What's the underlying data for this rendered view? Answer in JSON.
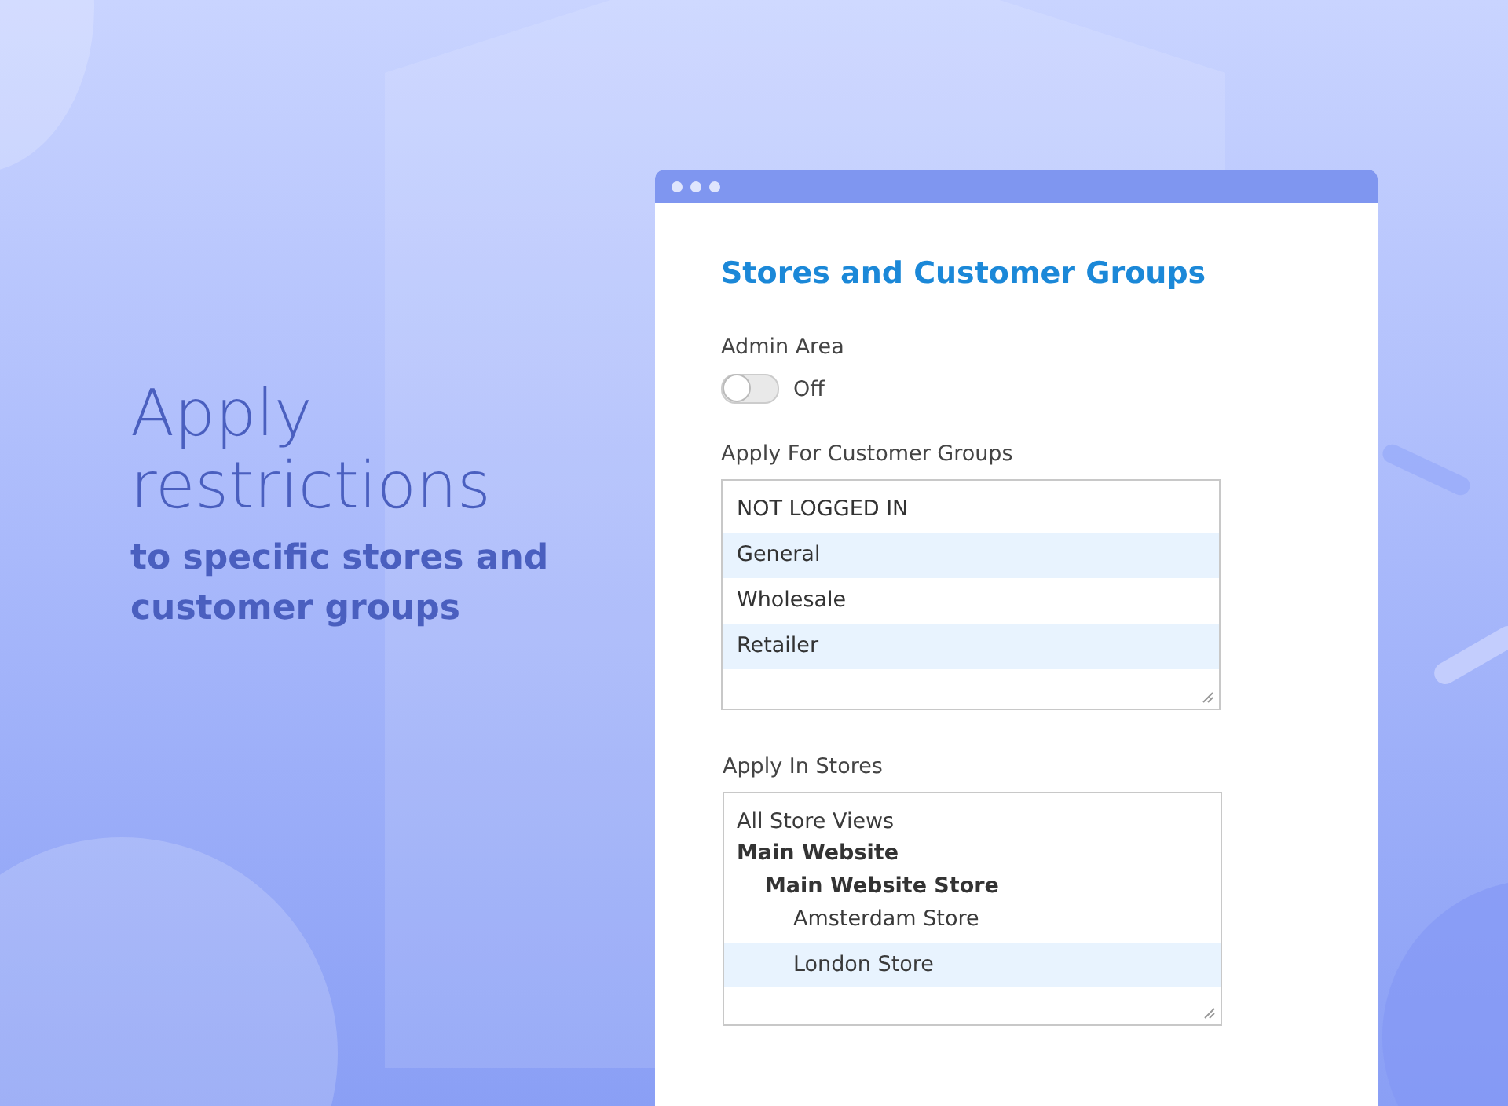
{
  "hero": {
    "headline": "Apply restrictions",
    "subline": "to specific stores and customer groups"
  },
  "window": {
    "title": "Stores and Customer Groups",
    "admin_area": {
      "label": "Admin Area",
      "on": false,
      "state_text": "Off"
    },
    "customer_groups": {
      "label": "Apply For Customer Groups",
      "items": [
        {
          "label": "NOT LOGGED IN",
          "selected": false
        },
        {
          "label": "General",
          "selected": true
        },
        {
          "label": "Wholesale",
          "selected": false
        },
        {
          "label": "Retailer",
          "selected": true
        }
      ]
    },
    "stores": {
      "label": "Apply In Stores",
      "items": [
        {
          "label": "All Store Views",
          "kind": "option",
          "selected": false
        },
        {
          "label": "Main Website",
          "kind": "group",
          "selected": false,
          "children": [
            {
              "label": "Main Website Store",
              "kind": "group",
              "selected": false,
              "children": [
                {
                  "label": "Amsterdam Store",
                  "kind": "option",
                  "selected": false
                },
                {
                  "label": "London Store",
                  "kind": "option",
                  "selected": true
                }
              ]
            }
          ]
        }
      ]
    }
  }
}
